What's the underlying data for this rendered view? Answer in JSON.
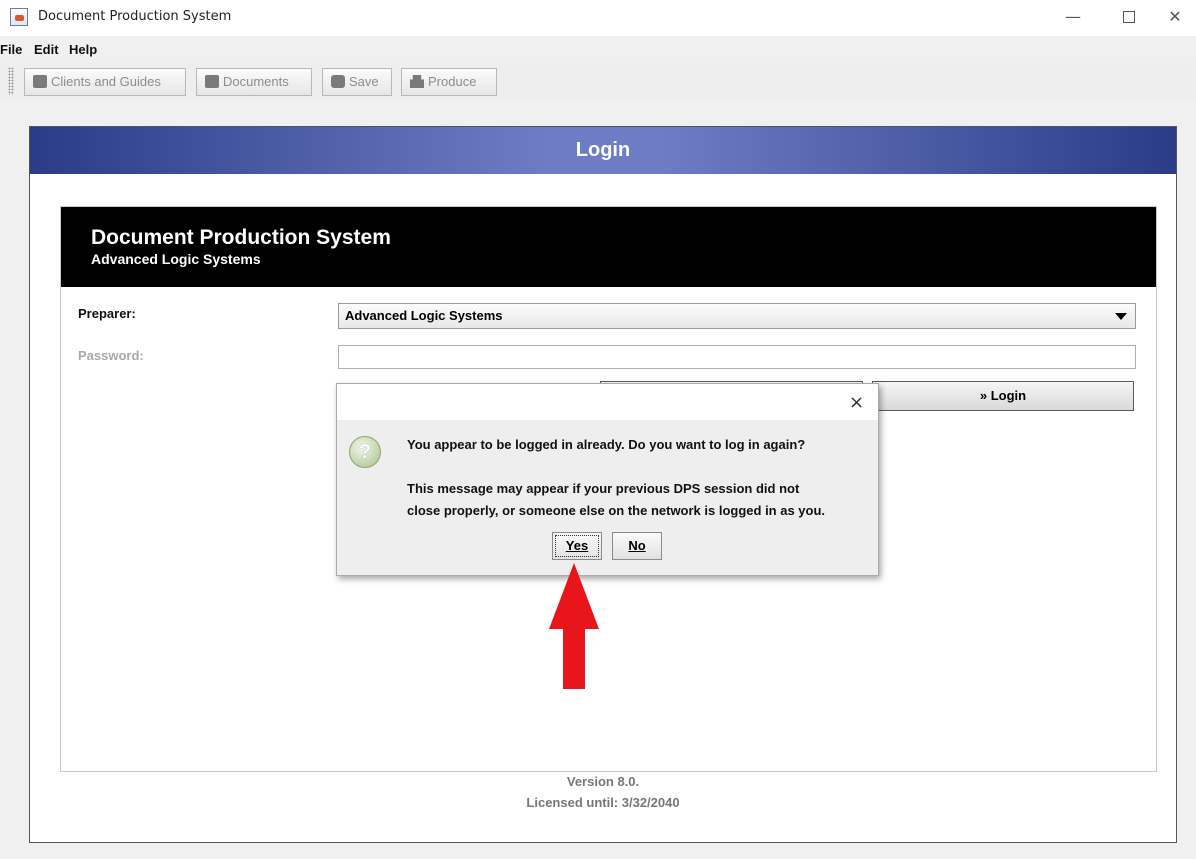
{
  "window": {
    "title": "Document Production System",
    "controls": [
      "—",
      "☐",
      "✕"
    ]
  },
  "menubar": {
    "items": [
      "File",
      "Edit",
      "Help"
    ]
  },
  "toolbar": {
    "buttons": [
      {
        "label": "Clients and Guides",
        "icon": "briefcase-icon"
      },
      {
        "label": "Documents",
        "icon": "briefcase-icon"
      },
      {
        "label": "Save",
        "icon": "disk-icon"
      },
      {
        "label": "Produce",
        "icon": "printer-icon"
      }
    ]
  },
  "login": {
    "header": "Login",
    "banner": {
      "title": "Document Production System",
      "subtitle": "Advanced Logic Systems"
    },
    "preparer_label": "Preparer:",
    "preparer_value": "Advanced Logic Systems",
    "password_label": "Password:",
    "password_value": "",
    "login_button": "Login",
    "login_button_icon": "double-chevron-right-icon"
  },
  "footer": {
    "version": "Version 8.0.",
    "license": "Licensed until: 3/32/2040"
  },
  "dialog": {
    "close": "×",
    "icon": "question-icon",
    "icon_glyph": "?",
    "line1": "You appear to be logged in already. Do you want to log in again?",
    "line2": "This message may appear if your previous DPS session did not",
    "line3": "close properly, or someone else on the network is logged in as you.",
    "yes": "Yes",
    "no": "No"
  },
  "annotation": {
    "arrow_color": "#e8151b",
    "points_to": "Yes"
  }
}
